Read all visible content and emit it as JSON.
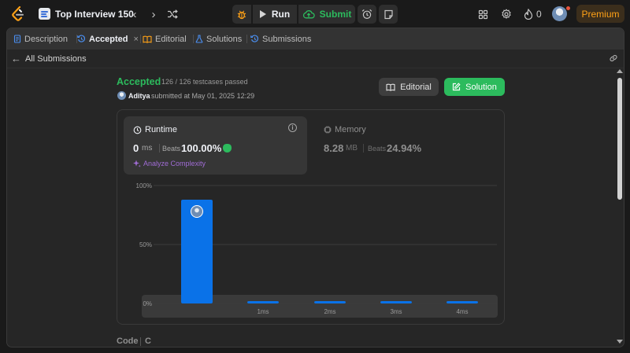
{
  "topbar": {
    "list_title": "Top Interview 150",
    "run_label": "Run",
    "submit_label": "Submit",
    "streak_count": "0",
    "premium_label": "Premium"
  },
  "tabs": [
    {
      "label": "Description"
    },
    {
      "label": "Accepted",
      "close": "×"
    },
    {
      "label": "Editorial"
    },
    {
      "label": "Solutions"
    },
    {
      "label": "Submissions"
    }
  ],
  "back": {
    "label": "All Submissions"
  },
  "submission": {
    "status": "Accepted",
    "testcases": "126 / 126 testcases passed",
    "user": "Aditya",
    "submitted_at": "submitted at May 01, 2025 12:29",
    "editorial_button": "Editorial",
    "solution_button": "Solution"
  },
  "runtime": {
    "label": "Runtime",
    "value": "0",
    "unit": "ms",
    "beats_label": "Beats",
    "beats_pct": "100.00%",
    "analyze_label": "Analyze Complexity"
  },
  "memory": {
    "label": "Memory",
    "value": "8.28",
    "unit": "MB",
    "beats_label": "Beats",
    "beats_pct": "24.94%"
  },
  "chart_data": {
    "type": "bar",
    "categories": [
      "0ms",
      "1ms",
      "2ms",
      "3ms",
      "4ms"
    ],
    "category_labels_shown": [
      "",
      "1ms",
      "2ms",
      "3ms",
      "4ms"
    ],
    "values": [
      88,
      2,
      2,
      2,
      2
    ],
    "yticks": [
      "100%",
      "50%",
      "0%"
    ],
    "ylim": [
      0,
      100
    ],
    "highlight_index": 0,
    "mini_map_labels": [
      "1ms",
      "2ms",
      "3ms",
      "4ms"
    ],
    "colors": {
      "bar": "#0a72e8",
      "grid": "#3c3c3c",
      "mini_active": "#525252",
      "mini_bar": "#4a4a4a"
    }
  },
  "code": {
    "label": "Code",
    "language": "C"
  }
}
